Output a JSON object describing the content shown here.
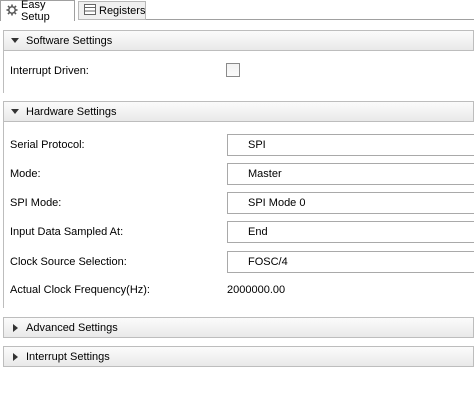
{
  "tabs": {
    "easy_setup": {
      "label": "Easy Setup",
      "icon": "gear-icon"
    },
    "registers": {
      "label": "Registers",
      "icon": "table-icon"
    }
  },
  "software": {
    "title": "Software Settings",
    "interrupt_driven_label": "Interrupt Driven:",
    "interrupt_driven_checked": false
  },
  "hardware": {
    "title": "Hardware Settings",
    "serial_protocol_label": "Serial Protocol:",
    "serial_protocol_value": "SPI",
    "mode_label": "Mode:",
    "mode_value": "Master",
    "spi_mode_label": "SPI Mode:",
    "spi_mode_value": "SPI Mode 0",
    "input_sampled_label": "Input Data Sampled At:",
    "input_sampled_value": "End",
    "clock_source_label": "Clock Source Selection:",
    "clock_source_value": "FOSC/4",
    "clock_freq_label": "Actual Clock Frequency(Hz):",
    "clock_freq_value": "2000000.00"
  },
  "advanced": {
    "title": "Advanced Settings"
  },
  "interrupt": {
    "title": "Interrupt Settings"
  }
}
